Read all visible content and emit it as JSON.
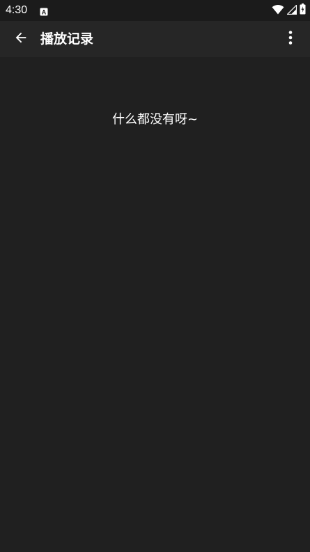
{
  "status_bar": {
    "time": "4:30",
    "notification_icon": "a-notification-icon",
    "wifi_icon": "wifi-icon",
    "signal_icon": "signal-icon",
    "battery_icon": "battery-charging-icon"
  },
  "app_bar": {
    "back_icon": "arrow-back-icon",
    "title": "播放记录",
    "more_icon": "more-vert-icon"
  },
  "content": {
    "empty_message": "什么都没有呀~"
  },
  "colors": {
    "background": "#202020",
    "app_bar": "#262626",
    "status_bar": "#1b1b1b",
    "text": "#ffffff"
  }
}
